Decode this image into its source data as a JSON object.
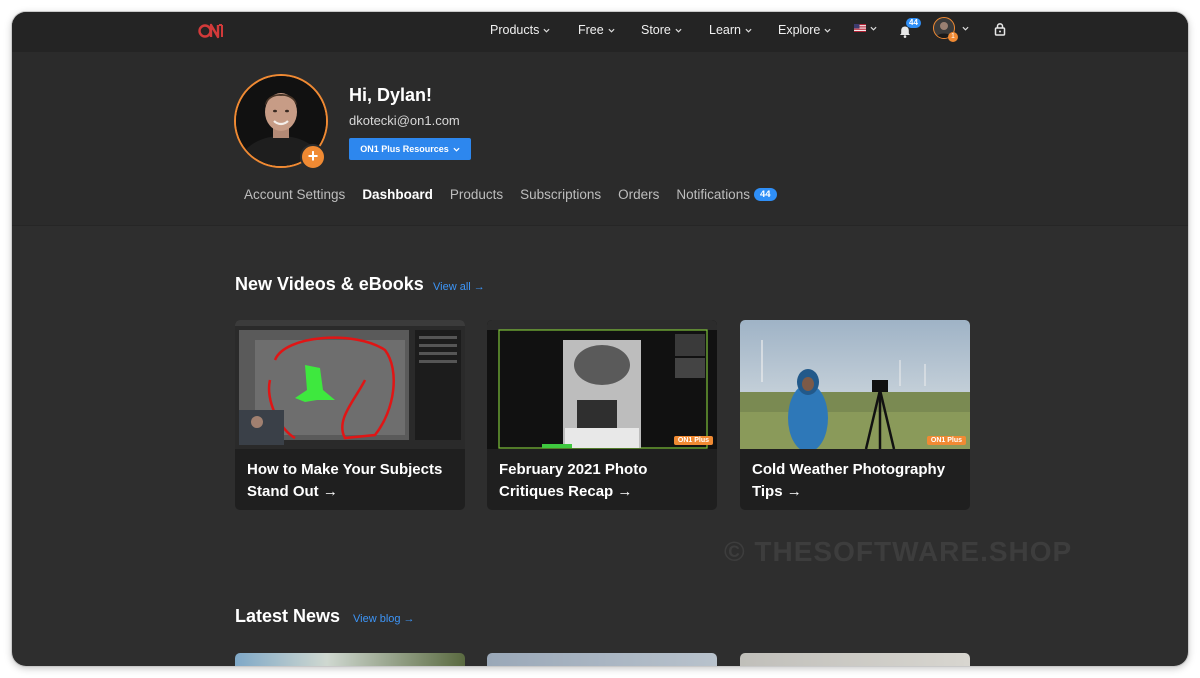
{
  "nav": {
    "logo_text": "ON1",
    "items": [
      {
        "label": "Products"
      },
      {
        "label": "Free"
      },
      {
        "label": "Store"
      },
      {
        "label": "Learn"
      },
      {
        "label": "Explore"
      }
    ],
    "notification_count": "44",
    "avatar_badge": "1"
  },
  "profile": {
    "greeting": "Hi, Dylan!",
    "email": "dkotecki@on1.com",
    "resources_button": "ON1 Plus Resources",
    "avatar_add": "+"
  },
  "tabs": [
    {
      "label": "Account Settings"
    },
    {
      "label": "Dashboard"
    },
    {
      "label": "Products"
    },
    {
      "label": "Subscriptions"
    },
    {
      "label": "Orders"
    },
    {
      "label": "Notifications",
      "count": "44"
    }
  ],
  "videos": {
    "title": "New Videos & eBooks",
    "link": "View all →",
    "cards": [
      {
        "title": "How to Make Your Subjects Stand Out →"
      },
      {
        "title": "February 2021 Photo Critiques Recap →",
        "tag": "ON1 Plus"
      },
      {
        "title": "Cold Weather Photography Tips →",
        "tag": "ON1 Plus"
      }
    ]
  },
  "news": {
    "title": "Latest News",
    "link": "View blog →"
  },
  "watermark": "© THESOFTWARE.SHOP",
  "colors": {
    "accent_blue": "#2d87ee",
    "accent_orange": "#f08a33",
    "background": "#2e2e2e",
    "nav_background": "#242424"
  }
}
